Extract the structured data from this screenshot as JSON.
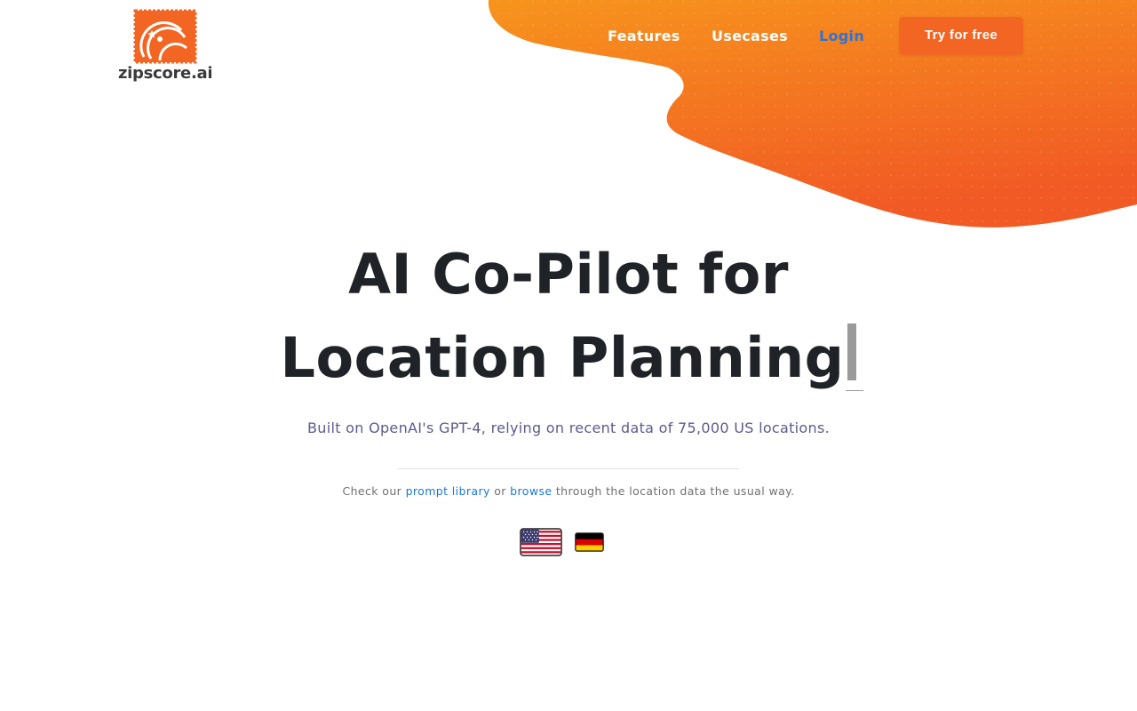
{
  "brand": {
    "name": "zipscore.ai",
    "accent_color": "#f26522",
    "gradient_light": "#f7941d"
  },
  "nav": {
    "features_label": "Features",
    "usecases_label": "Usecases",
    "login_label": "Login",
    "cta_label": "Try for free"
  },
  "hero": {
    "title_line1": "AI Co-Pilot for",
    "title_line2": "Location Planning",
    "subtitle": "Built on OpenAI's GPT-4, relying on recent data of 75,000 US locations."
  },
  "library_line": {
    "prefix": "Check our",
    "prompt_library_link": "prompt library",
    "middle": "or",
    "browse_link": "browse",
    "suffix": "through the location data the usual way."
  },
  "languages": [
    {
      "icon": "us-flag-icon"
    },
    {
      "icon": "germany-flag-icon"
    }
  ]
}
